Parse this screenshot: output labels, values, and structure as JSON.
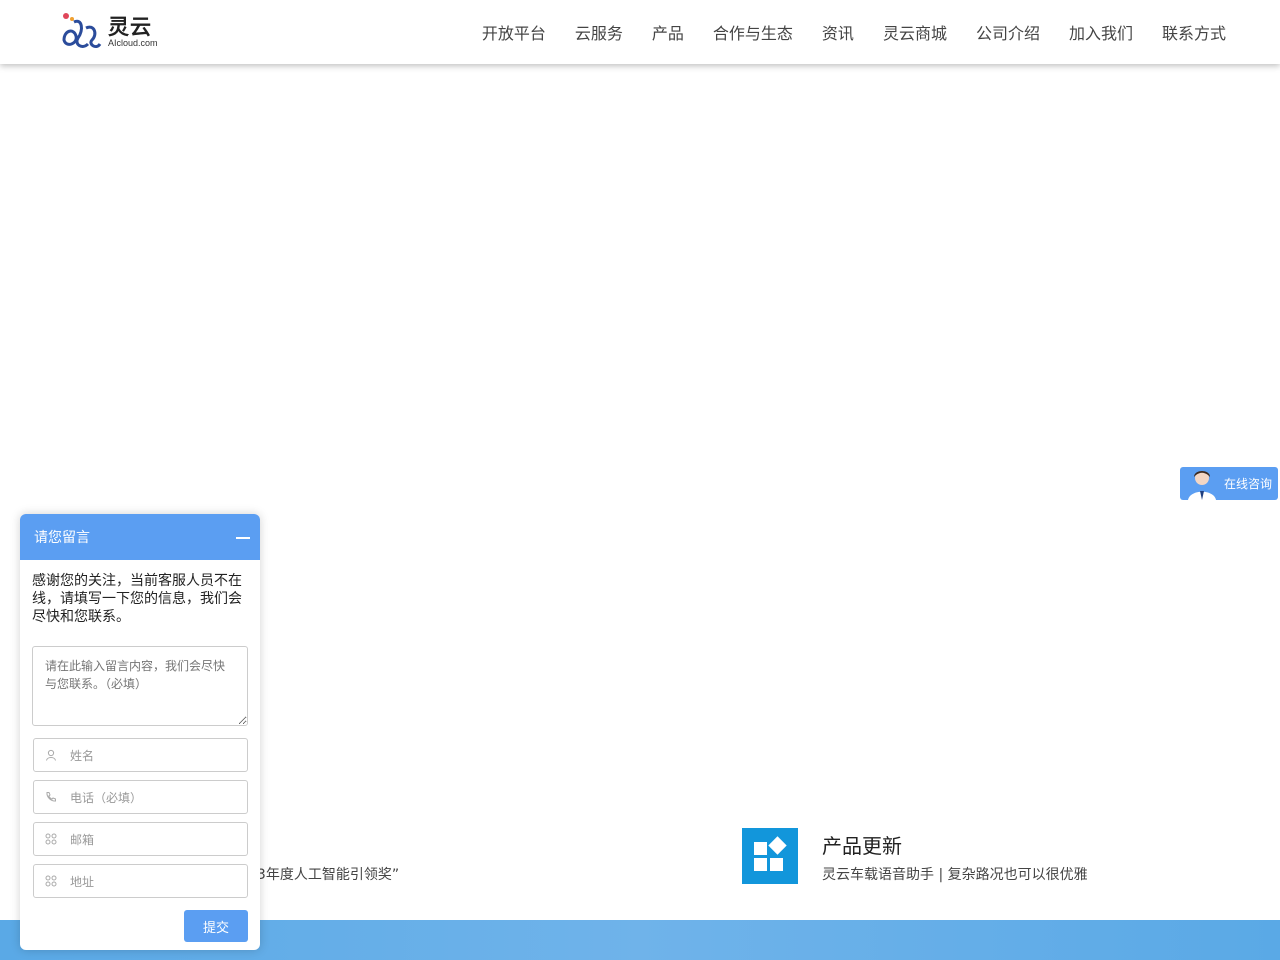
{
  "brand": {
    "name_cn": "灵云",
    "domain": "AIcloud.com"
  },
  "nav": {
    "items": [
      {
        "label": "开放平台"
      },
      {
        "label": "云服务"
      },
      {
        "label": "产品"
      },
      {
        "label": "合作与生态"
      },
      {
        "label": "资讯"
      },
      {
        "label": "灵云商城"
      },
      {
        "label": "公司介绍"
      },
      {
        "label": "加入我们"
      },
      {
        "label": "联系方式"
      }
    ]
  },
  "news": {
    "left_snippet": "23年度人工智能引领奖”",
    "product_title": "产品更新",
    "product_desc": "灵云车载语音助手 | 复杂路况也可以很优雅"
  },
  "consult": {
    "label": "在线咨询"
  },
  "message_panel": {
    "title": "请您留言",
    "notice": "感谢您的关注，当前客服人员不在线，请填写一下您的信息，我们会尽快和您联系。",
    "message_placeholder": "请在此输入留言内容，我们会尽快与您联系。（必填）",
    "fields": {
      "name": "姓名",
      "phone": "电话（必填）",
      "email": "邮箱",
      "address": "地址"
    },
    "submit_label": "提交"
  },
  "colors": {
    "accent": "#5b9ef2",
    "product_icon": "#1296db",
    "footer_band": "#6fb3ea"
  },
  "icons": {
    "logo": "linkcloud-logo",
    "product": "grid-blocks-icon",
    "name_field": "user-icon",
    "phone_field": "phone-icon",
    "email_field": "grid-icon",
    "address_field": "grid-icon"
  }
}
